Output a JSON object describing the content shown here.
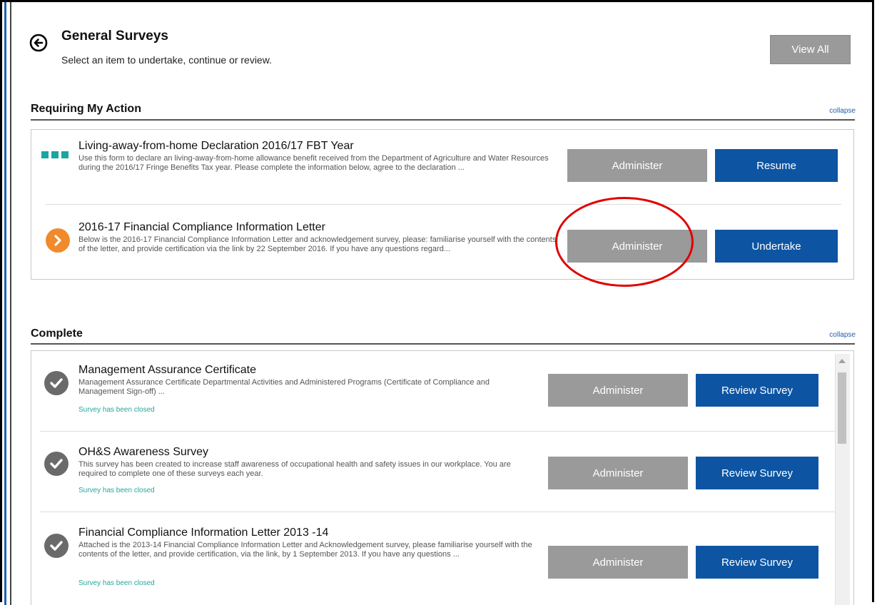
{
  "header": {
    "title": "General Surveys",
    "subtitle": "Select an item to undertake, continue or review.",
    "view_all_label": "View All",
    "back_icon": "circle-arrow-left-icon"
  },
  "requiring": {
    "title": "Requiring My Action",
    "collapse_label": "collapse",
    "items": [
      {
        "title": "Living-away-from-home Declaration 2016/17 FBT Year",
        "description": "Use this form to declare an living-away-from-home allowance benefit received from the Department of Agriculture and Water Resources during the 2016/17 Fringe Benefits Tax year. Please complete the information below, agree to the declaration ...",
        "icon": "in-progress-dots-icon",
        "administer_label": "Administer",
        "action_label": "Resume"
      },
      {
        "title": "2016-17 Financial Compliance Information Letter",
        "description": "Below is the 2016-17 Financial Compliance Information Letter and acknowledgement survey, please: familiarise yourself with the contents of the letter, and provide certification via the link by 22 September 2016. If you have any questions regard...",
        "icon": "chevron-right-circle-icon",
        "administer_label": "Administer",
        "action_label": "Undertake"
      }
    ]
  },
  "complete": {
    "title": "Complete",
    "collapse_label": "collapse",
    "items": [
      {
        "title": "Management Assurance Certificate",
        "description": "Management Assurance Certificate Departmental Activities and Administered Programs (Certificate of Compliance and Management Sign-off) ...",
        "status": "Survey has been closed",
        "administer_label": "Administer",
        "action_label": "Review Survey"
      },
      {
        "title": "OH&S Awareness Survey",
        "description": "This survey has been created to increase staff awareness of occupational health and safety issues in our workplace. You are required to complete one of these surveys each year.",
        "status": "Survey has been closed",
        "administer_label": "Administer",
        "action_label": "Review Survey"
      },
      {
        "title": "Financial Compliance Information Letter 2013 -14",
        "description": "Attached is the 2013-14 Financial Compliance Information Letter and Acknowledgement survey, please familiarise yourself with the contents of the letter, and provide certification, via the link, by 1 September 2013. If you have any questions ...",
        "status": "Survey has been closed",
        "administer_label": "Administer",
        "action_label": "Review Survey"
      }
    ]
  },
  "colors": {
    "primary_blue": "#0d55a3",
    "button_grey": "#9a9a9a",
    "status_teal": "#22a89a",
    "orange_accent": "#f08a2c",
    "highlight_red": "#e00000"
  }
}
